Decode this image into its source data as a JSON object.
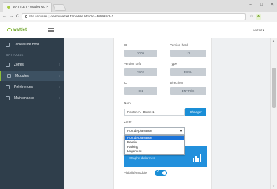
{
  "browser": {
    "tab_title": "WATTLET - Wattlet Mo",
    "tab_close": "×",
    "url_security": "Site sécurisé",
    "url_sep": "|",
    "url": "demo.wattlet.fr/module.html?id=3009&sid=1",
    "window": {
      "minimize": "–",
      "maximize": "□",
      "close": "×"
    },
    "nav": {
      "back": "←",
      "forward": "→",
      "reload": "C"
    },
    "icons": [
      "star-icon",
      "extension-icon",
      "menu-icon"
    ]
  },
  "app": {
    "logo_text": "wattlet",
    "user_menu": "wattlet ▾"
  },
  "sidebar": {
    "dashboard": "Tableau de bord",
    "section": "WATTOUSE",
    "items": [
      {
        "label": "Zones",
        "chevron": "‹"
      },
      {
        "label": "Modules",
        "chevron": "‹"
      },
      {
        "label": "Préférences",
        "chevron": "‹"
      },
      {
        "label": "Maintenance",
        "chevron": "‹"
      }
    ]
  },
  "form": {
    "id_label": "ID",
    "id_value": "3009",
    "hw_label": "Version hard",
    "hw_value": "12",
    "sw_label": "Version soft",
    "sw_value": "2902",
    "type_label": "Type",
    "type_value": "PUSH",
    "io_label": "IO",
    "io_value": "IO1",
    "dir_label": "Direction",
    "dir_value": "ENTRÉE",
    "name_label": "Nom",
    "name_value": "Ponton A - Borne 1",
    "change_button": "Changer",
    "zone_label": "Zone",
    "zone_selected": "Port de plaisance",
    "zone_arrow": "▾",
    "zone_options": [
      "Port de plaisance",
      "Bassin",
      "Parking",
      "Logement"
    ],
    "panel_text": "Graphe d'alarmes",
    "visibility_label": "Visibilité module",
    "visibility_on": true,
    "toggle_check": "✓"
  },
  "colors": {
    "sidebar_bg": "#2f3e4b",
    "accent_blue": "#1a8ed6",
    "brand_green": "#8fbf3a",
    "field_grey": "#c7cdd3"
  }
}
